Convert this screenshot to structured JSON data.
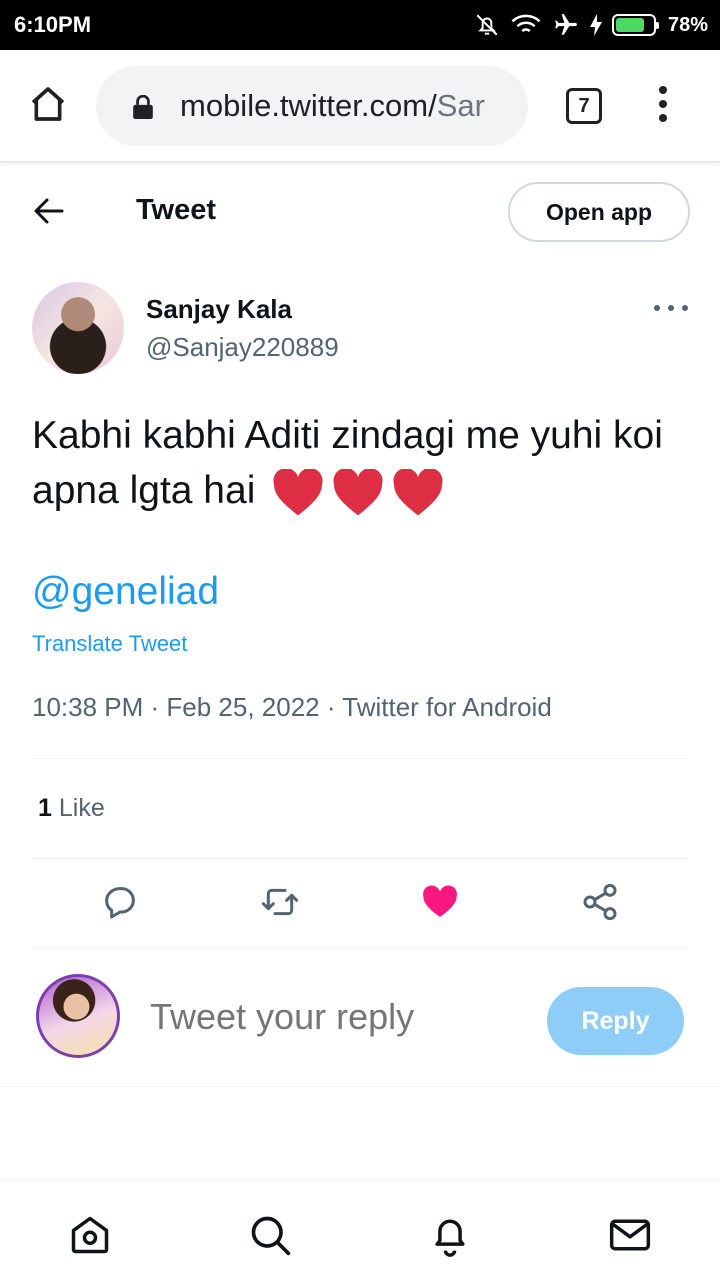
{
  "status_bar": {
    "time": "6:10PM",
    "battery": "78%",
    "battery_level": 0.78
  },
  "browser": {
    "url_host": "mobile.twitter.com/",
    "url_rest": "Sar",
    "tab_count": "7"
  },
  "header": {
    "title": "Tweet",
    "open_app": "Open app"
  },
  "tweet": {
    "author_name": "Sanjay Kala",
    "author_handle": "@Sanjay220889",
    "text": "Kabhi kabhi Aditi zindagi me yuhi koi apna lgta hai",
    "mention": "@geneliad",
    "translate": "Translate Tweet",
    "meta": "10:38 PM · Feb 25, 2022 · Twitter for Android",
    "like_count": "1",
    "like_label": "Like"
  },
  "reply": {
    "placeholder": "Tweet your reply",
    "button": "Reply"
  },
  "colors": {
    "accent": "#1d9bf0",
    "like": "#f91880",
    "heart_emoji": "#dd2e44",
    "reply_button": "#8ecdf8"
  },
  "icons": {
    "actions": [
      "reply-icon",
      "retweet-icon",
      "like-icon",
      "share-icon"
    ],
    "nav": [
      "home-icon",
      "search-icon",
      "notifications-icon",
      "messages-icon"
    ]
  }
}
